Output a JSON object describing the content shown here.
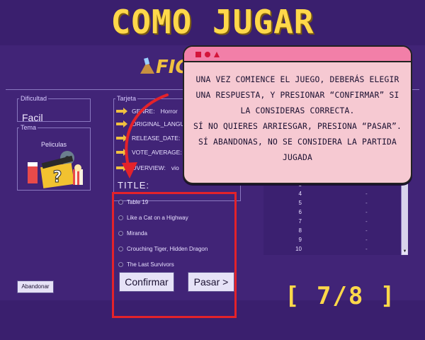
{
  "title": "COMO JUGAR",
  "app": {
    "logo_text": "FIG",
    "dificultad": {
      "legend": "Dificultad",
      "value": "Facil"
    },
    "tema": {
      "legend": "Tema",
      "value": "Peliculas"
    },
    "tarjeta": {
      "legend": "Tarjeta",
      "attributes": [
        {
          "label": "GENRE:",
          "value": "Horror"
        },
        {
          "label": "ORIGINAL_LANGU",
          "value": ""
        },
        {
          "label": "RELEASE_DATE:",
          "value": ""
        },
        {
          "label": "VOTE_AVERAGE:",
          "value": ""
        },
        {
          "label": "OVERVIEW:",
          "value": "vio"
        }
      ]
    },
    "question_label": "TITLE:",
    "options": [
      "Table 19",
      "Like a Cat on a Highway",
      "Miranda",
      "Crouching Tiger, Hidden Dragon",
      "The Last Survivors"
    ],
    "confirm_label": "Confirmar",
    "skip_label": "Pasar >",
    "abandon_label": "Abandonar",
    "ranking": {
      "rows": [
        {
          "num": "3",
          "score": "-"
        },
        {
          "num": "4",
          "score": "-"
        },
        {
          "num": "5",
          "score": "-"
        },
        {
          "num": "6",
          "score": "-"
        },
        {
          "num": "7",
          "score": "-"
        },
        {
          "num": "8",
          "score": "-"
        },
        {
          "num": "9",
          "score": "-"
        },
        {
          "num": "10",
          "score": "-"
        }
      ]
    }
  },
  "popup": {
    "text": "UNA VEZ COMIENCE EL JUEGO, DEBERÁS ELEGIR\nUNA RESPUESTA, Y PRESIONAR “CONFIRMAR” SI\nLA CONSIDERAS CORRECTA.\nSÍ NO QUIERES ARRIESGAR, PRESIONA “PASAR”.\nSÍ ABANDONAS, NO SE CONSIDERA LA PARTIDA\nJUGADA"
  },
  "progress": "[ 7/8 ]",
  "colors": {
    "background": "#3a1f6e",
    "title": "#ffd84a",
    "highlight": "#e4222a",
    "popup_bg": "#f6c9d2",
    "popup_header": "#f27fa8"
  }
}
